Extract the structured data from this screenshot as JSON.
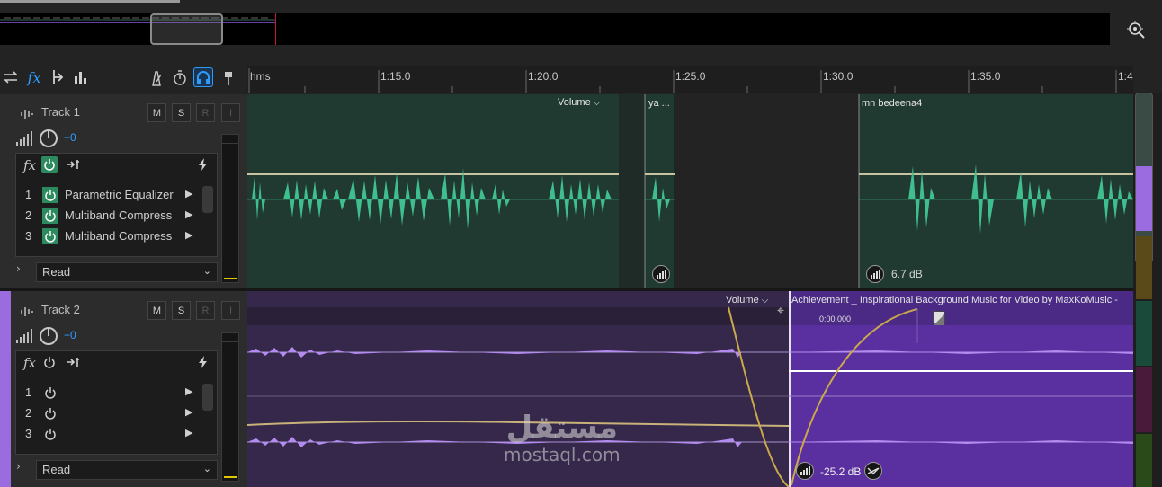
{
  "ruler": {
    "unit": "hms",
    "ticks": [
      "1:15.0",
      "1:20.0",
      "1:25.0",
      "1:30.0",
      "1:35.0",
      "1:4"
    ]
  },
  "tracks": [
    {
      "name": "Track 1",
      "buttons": [
        "M",
        "S",
        "R",
        "I"
      ],
      "volume": "+0",
      "effects": [
        {
          "num": "1",
          "name": "Parametric Equalizer"
        },
        {
          "num": "2",
          "name": "Multiband Compress"
        },
        {
          "num": "3",
          "name": "Multiband Compress"
        }
      ],
      "automation": "Read",
      "color": "#2a3f36",
      "clips": [
        {
          "label": "Volume"
        },
        {
          "label": "ya ..."
        },
        {
          "label": "mn bedeena4"
        }
      ],
      "clip_gain": "6.7 dB"
    },
    {
      "name": "Track 2",
      "buttons": [
        "M",
        "S",
        "R",
        "I"
      ],
      "volume": "+0",
      "effects": [
        {
          "num": "1",
          "name": ""
        },
        {
          "num": "2",
          "name": ""
        },
        {
          "num": "3",
          "name": ""
        }
      ],
      "automation": "Read",
      "color": "#3a2b4e",
      "clips": [
        {
          "label": "Volume"
        },
        {
          "label": "Achievement _ Inspirational Background Music for Video by MaxKoMusic -"
        }
      ],
      "clip_time": "0:00.000",
      "clip_gain": "-25.2 dB"
    }
  ],
  "watermark": {
    "arabic": "مستقل",
    "latin": "mostaql.com"
  },
  "colors": {
    "accent": "#2f9bff",
    "wave_green": "#3fbf8f",
    "wave_purple": "#b48cf0",
    "fade_line": "#c9a94a",
    "purple_track": "#9b6be0"
  }
}
